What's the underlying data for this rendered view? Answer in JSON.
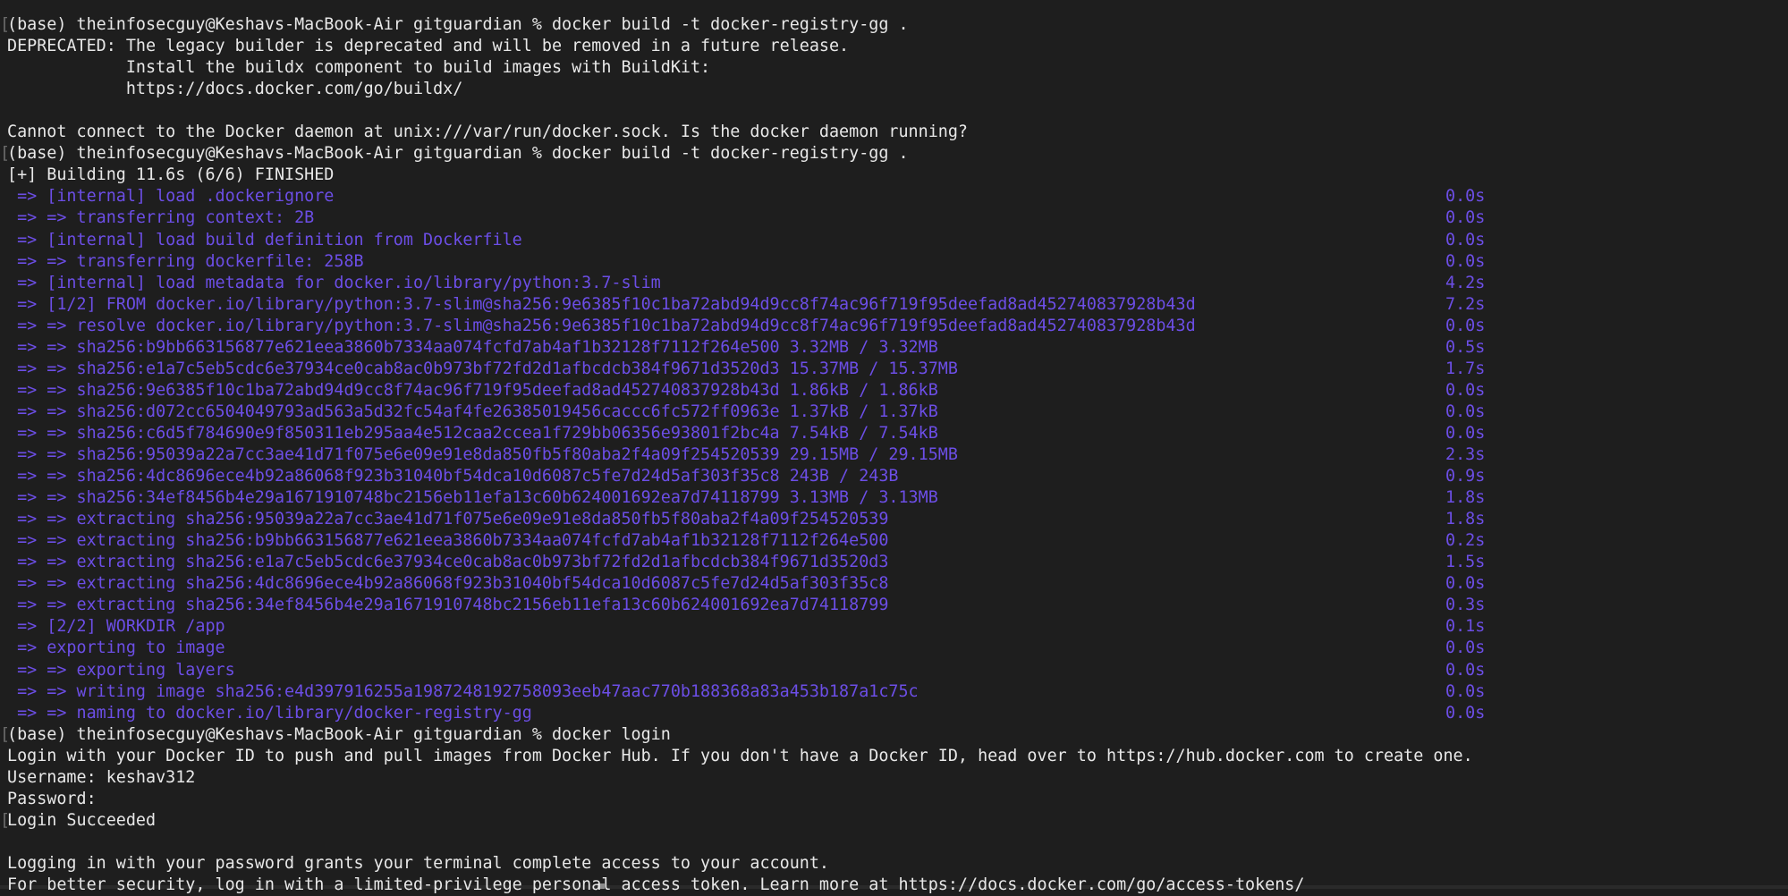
{
  "window": {
    "type": "terminal",
    "app": "Terminal"
  },
  "colors": {
    "background": "#1e1e1e",
    "text": "#e8e8e8",
    "buildkit_purple": "#6c4ee6"
  },
  "lines": [
    {
      "text": "(base) theinfosecguy@Keshavs-MacBook-Air gitguardian % docker build -t docker-registry-gg .",
      "style": "prompt",
      "marker": true
    },
    {
      "text": "DEPRECATED: The legacy builder is deprecated and will be removed in a future release.",
      "style": "normal"
    },
    {
      "text": "            Install the buildx component to build images with BuildKit:",
      "style": "normal"
    },
    {
      "text": "            https://docs.docker.com/go/buildx/",
      "style": "normal"
    },
    {
      "text": "",
      "style": "normal"
    },
    {
      "text": "Cannot connect to the Docker daemon at unix:///var/run/docker.sock. Is the docker daemon running?",
      "style": "normal"
    },
    {
      "text": "(base) theinfosecguy@Keshavs-MacBook-Air gitguardian % docker build -t docker-registry-gg .",
      "style": "prompt",
      "marker": true
    },
    {
      "text": "[+] Building 11.6s (6/6) FINISHED",
      "style": "normal"
    },
    {
      "text": " => [internal] load .dockerignore",
      "style": "purple",
      "time": "0.0s"
    },
    {
      "text": " => => transferring context: 2B",
      "style": "purple",
      "time": "0.0s"
    },
    {
      "text": " => [internal] load build definition from Dockerfile",
      "style": "purple",
      "time": "0.0s"
    },
    {
      "text": " => => transferring dockerfile: 258B",
      "style": "purple",
      "time": "0.0s"
    },
    {
      "text": " => [internal] load metadata for docker.io/library/python:3.7-slim",
      "style": "purple",
      "time": "4.2s"
    },
    {
      "text": " => [1/2] FROM docker.io/library/python:3.7-slim@sha256:9e6385f10c1ba72abd94d9cc8f74ac96f719f95deefad8ad452740837928b43d",
      "style": "purple",
      "time": "7.2s"
    },
    {
      "text": " => => resolve docker.io/library/python:3.7-slim@sha256:9e6385f10c1ba72abd94d9cc8f74ac96f719f95deefad8ad452740837928b43d",
      "style": "purple",
      "time": "0.0s"
    },
    {
      "text": " => => sha256:b9bb663156877e621eea3860b7334aa074fcfd7ab4af1b32128f7112f264e500 3.32MB / 3.32MB",
      "style": "purple",
      "time": "0.5s"
    },
    {
      "text": " => => sha256:e1a7c5eb5cdc6e37934ce0cab8ac0b973bf72fd2d1afbcdcb384f9671d3520d3 15.37MB / 15.37MB",
      "style": "purple",
      "time": "1.7s"
    },
    {
      "text": " => => sha256:9e6385f10c1ba72abd94d9cc8f74ac96f719f95deefad8ad452740837928b43d 1.86kB / 1.86kB",
      "style": "purple",
      "time": "0.0s"
    },
    {
      "text": " => => sha256:d072cc6504049793ad563a5d32fc54af4fe26385019456caccc6fc572ff0963e 1.37kB / 1.37kB",
      "style": "purple",
      "time": "0.0s"
    },
    {
      "text": " => => sha256:c6d5f784690e9f850311eb295aa4e512caa2ccea1f729bb06356e93801f2bc4a 7.54kB / 7.54kB",
      "style": "purple",
      "time": "0.0s"
    },
    {
      "text": " => => sha256:95039a22a7cc3ae41d71f075e6e09e91e8da850fb5f80aba2f4a09f254520539 29.15MB / 29.15MB",
      "style": "purple",
      "time": "2.3s"
    },
    {
      "text": " => => sha256:4dc8696ece4b92a86068f923b31040bf54dca10d6087c5fe7d24d5af303f35c8 243B / 243B",
      "style": "purple",
      "time": "0.9s"
    },
    {
      "text": " => => sha256:34ef8456b4e29a1671910748bc2156eb11efa13c60b624001692ea7d74118799 3.13MB / 3.13MB",
      "style": "purple",
      "time": "1.8s"
    },
    {
      "text": " => => extracting sha256:95039a22a7cc3ae41d71f075e6e09e91e8da850fb5f80aba2f4a09f254520539",
      "style": "purple",
      "time": "1.8s"
    },
    {
      "text": " => => extracting sha256:b9bb663156877e621eea3860b7334aa074fcfd7ab4af1b32128f7112f264e500",
      "style": "purple",
      "time": "0.2s"
    },
    {
      "text": " => => extracting sha256:e1a7c5eb5cdc6e37934ce0cab8ac0b973bf72fd2d1afbcdcb384f9671d3520d3",
      "style": "purple",
      "time": "1.5s"
    },
    {
      "text": " => => extracting sha256:4dc8696ece4b92a86068f923b31040bf54dca10d6087c5fe7d24d5af303f35c8",
      "style": "purple",
      "time": "0.0s"
    },
    {
      "text": " => => extracting sha256:34ef8456b4e29a1671910748bc2156eb11efa13c60b624001692ea7d74118799",
      "style": "purple",
      "time": "0.3s"
    },
    {
      "text": " => [2/2] WORKDIR /app",
      "style": "purple",
      "time": "0.1s"
    },
    {
      "text": " => exporting to image",
      "style": "purple",
      "time": "0.0s"
    },
    {
      "text": " => => exporting layers",
      "style": "purple",
      "time": "0.0s"
    },
    {
      "text": " => => writing image sha256:e4d397916255a1987248192758093eeb47aac770b188368a83a453b187a1c75c",
      "style": "purple",
      "time": "0.0s"
    },
    {
      "text": " => => naming to docker.io/library/docker-registry-gg",
      "style": "purple",
      "time": "0.0s"
    },
    {
      "text": "(base) theinfosecguy@Keshavs-MacBook-Air gitguardian % docker login",
      "style": "prompt",
      "marker": true
    },
    {
      "text": "Login with your Docker ID to push and pull images from Docker Hub. If you don't have a Docker ID, head over to https://hub.docker.com to create one.",
      "style": "normal"
    },
    {
      "text": "Username: keshav312",
      "style": "normal"
    },
    {
      "text": "Password:",
      "style": "normal"
    },
    {
      "text": "Login Succeeded",
      "style": "normal",
      "marker": true
    },
    {
      "text": "",
      "style": "normal"
    },
    {
      "text": "Logging in with your password grants your terminal complete access to your account.",
      "style": "normal"
    },
    {
      "text": "For better security, log in with a limited-privilege personal access token. Learn more at https://docs.docker.com/go/access-tokens/",
      "style": "normal"
    }
  ]
}
